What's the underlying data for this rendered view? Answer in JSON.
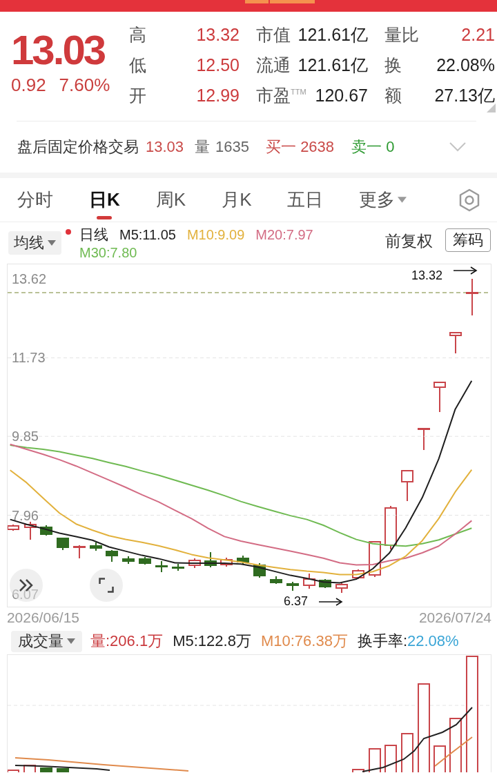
{
  "quote": {
    "price": "13.03",
    "change": "0.92",
    "change_percent": "7.60%",
    "stat_rows": [
      {
        "cells": [
          {
            "label": "高",
            "value": "13.32",
            "kind": "rise"
          },
          {
            "label": "市值",
            "value": "121.61亿",
            "kind": "plain"
          },
          {
            "label": "量比",
            "value": "2.21",
            "kind": "rise"
          }
        ]
      },
      {
        "cells": [
          {
            "label": "低",
            "value": "12.50",
            "kind": "rise"
          },
          {
            "label": "流通",
            "value": "121.61亿",
            "kind": "plain"
          },
          {
            "label": "换",
            "value": "22.08%",
            "kind": "plain"
          }
        ]
      },
      {
        "cells": [
          {
            "label": "开",
            "value": "12.99",
            "kind": "rise"
          },
          {
            "label": "市盈$^{TTM}$",
            "value": "120.67",
            "kind": "plain"
          },
          {
            "label": "额",
            "value": "27.13亿",
            "kind": "plain"
          }
        ]
      }
    ]
  },
  "after_hours": {
    "label": "盘后固定价格交易",
    "price": "13.03",
    "volume_label": "量",
    "volume": "1635",
    "bid": "买一 2638",
    "ask": "卖一 0",
    "expanded": false
  },
  "tabs": [
    {
      "label": "分时",
      "selected": false,
      "kind": "plain"
    },
    {
      "label": "日K",
      "selected": true,
      "kind": "plain"
    },
    {
      "label": "周K",
      "selected": false,
      "kind": "plain"
    },
    {
      "label": "月K",
      "selected": false,
      "kind": "plain"
    },
    {
      "label": "五日",
      "selected": false,
      "kind": "plain"
    },
    {
      "label": "更多",
      "selected": false,
      "kind": "menu"
    }
  ],
  "legend": {
    "ma_selector": "均线",
    "period": "日线",
    "lines": [
      {
        "label": "M5:11.05",
        "color": "#1f1f1f"
      },
      {
        "label": "M10:9.09",
        "color": "#e2b13c"
      },
      {
        "label": "M20:7.97",
        "color": "#d36c84"
      },
      {
        "label": "M30:7.80",
        "color": "#6fba52"
      }
    ],
    "adjust": "前复权",
    "chips": "筹码"
  },
  "price_chart": {
    "chart_data": {
      "type": "line",
      "grid": true,
      "categories": [
        null,
        null,
        "2026/06/15",
        null,
        null,
        null,
        null,
        null,
        null,
        null,
        null,
        null,
        null,
        null,
        null,
        null,
        null,
        null,
        null,
        null,
        null,
        null,
        null,
        null,
        null,
        null,
        null,
        "2026/07/24",
        null
      ],
      "ylim": [
        5.77,
        13.97
      ],
      "yticks": [
        13.62,
        11.73,
        9.85,
        7.96,
        6.07
      ],
      "series": [
        {
          "color": "#1f1f1f",
          "values": [
            7.86,
            7.74,
            7.64,
            7.53,
            7.45,
            7.36,
            7.2,
            7.1,
            7.0,
            6.92,
            6.82,
            6.81,
            6.81,
            6.81,
            6.79,
            6.72,
            6.62,
            6.52,
            6.45,
            6.36,
            6.34,
            6.43,
            6.68,
            7.05,
            7.66,
            8.38,
            9.31,
            10.5,
            11.18
          ]
        },
        {
          "color": "#e2b13c",
          "values": [
            9.04,
            8.74,
            8.37,
            8.01,
            7.75,
            7.6,
            7.47,
            7.38,
            7.31,
            7.23,
            7.13,
            7.02,
            6.94,
            6.89,
            6.84,
            6.77,
            6.71,
            6.66,
            6.62,
            6.59,
            6.54,
            6.54,
            6.61,
            6.75,
            6.98,
            7.35,
            7.88,
            8.52,
            9.05
          ]
        },
        {
          "color": "#d36c84",
          "values": [
            9.66,
            9.54,
            9.42,
            9.29,
            9.14,
            8.97,
            8.8,
            8.63,
            8.45,
            8.28,
            8.08,
            7.88,
            7.65,
            7.45,
            7.34,
            7.26,
            7.18,
            7.1,
            7.02,
            6.93,
            6.82,
            6.77,
            6.78,
            6.87,
            6.93,
            7.06,
            7.22,
            7.51,
            7.83
          ]
        },
        {
          "color": "#6fba52",
          "values": [
            9.64,
            9.58,
            9.54,
            9.48,
            9.4,
            9.32,
            9.22,
            9.13,
            9.02,
            8.92,
            8.8,
            8.68,
            8.56,
            8.43,
            8.29,
            8.17,
            8.06,
            7.95,
            7.86,
            7.72,
            7.54,
            7.38,
            7.28,
            7.24,
            7.22,
            7.28,
            7.37,
            7.51,
            7.65
          ]
        }
      ]
    },
    "high_note": "13.32",
    "low_note": "6.37"
  },
  "volume": {
    "selector": "成交量",
    "items": [
      {
        "label": "量:206.1万",
        "color": "#c9383c"
      },
      {
        "label": "M5:122.8万",
        "color": "#222222"
      },
      {
        "label": "M10:76.38万",
        "color": "#e08a4c"
      }
    ],
    "turnover_label": "换手率:",
    "turnover_value": "22.08%"
  }
}
